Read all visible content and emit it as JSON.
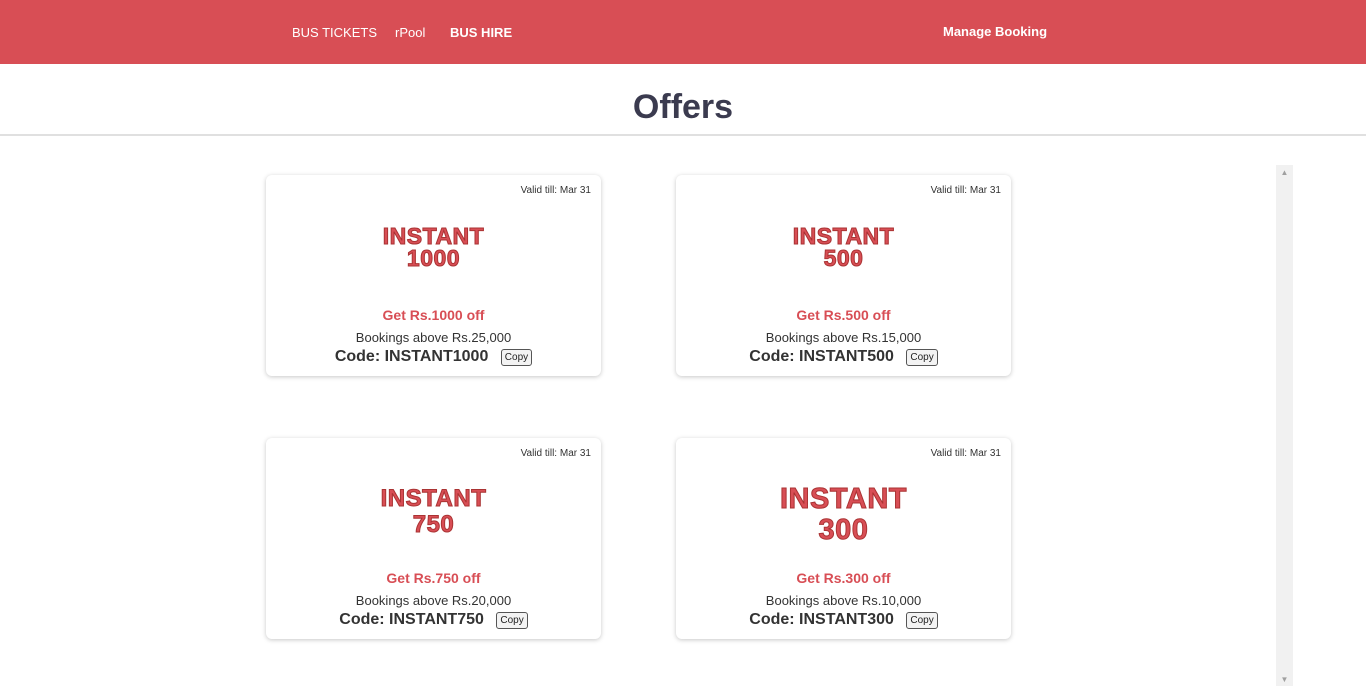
{
  "nav": {
    "bus_tickets": "BUS TICKETS",
    "rpool": "rPool",
    "bus_hire": "BUS HIRE",
    "manage_booking": "Manage Booking"
  },
  "page": {
    "title": "Offers"
  },
  "colors": {
    "brand": "#d84e55",
    "text_dark": "#3b3b4f"
  },
  "offers": [
    {
      "valid": "Valid till: Mar 31",
      "logo_line1": "INSTANT",
      "logo_line2": "1000",
      "headline": "Get Rs.1000 off",
      "condition": "Bookings above Rs.25,000",
      "code": "Code: INSTANT1000",
      "copy_label": "Copy"
    },
    {
      "valid": "Valid till: Mar 31",
      "logo_line1": "INSTANT",
      "logo_line2": "500",
      "headline": "Get Rs.500 off",
      "condition": "Bookings above Rs.15,000",
      "code": "Code: INSTANT500",
      "copy_label": "Copy"
    },
    {
      "valid": "Valid till: Mar 31",
      "logo_line1": "INSTANT",
      "logo_line2": "750",
      "headline": "Get Rs.750 off",
      "condition": "Bookings above Rs.20,000",
      "code": "Code: INSTANT750",
      "copy_label": "Copy"
    },
    {
      "valid": "Valid till: Mar 31",
      "logo_line1": "INSTANT",
      "logo_line2": "300",
      "headline": "Get Rs.300 off",
      "condition": "Bookings above Rs.10,000",
      "code": "Code: INSTANT300",
      "copy_label": "Copy"
    }
  ]
}
